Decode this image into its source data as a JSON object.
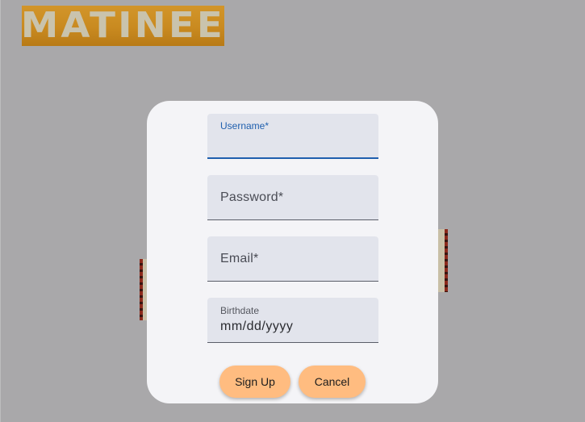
{
  "app": {
    "logo_text": "MATINEE"
  },
  "form": {
    "username": {
      "label": "Username*",
      "value": ""
    },
    "password": {
      "label": "Password*",
      "value": ""
    },
    "email": {
      "label": "Email*",
      "value": ""
    },
    "birthdate": {
      "label": "Birthdate",
      "placeholder": "mm/dd/yyyy"
    }
  },
  "buttons": {
    "sign_up": "Sign Up",
    "cancel": "Cancel"
  },
  "colors": {
    "background": "#a9a8aa",
    "dialog": "#f4f4f7",
    "field": "#e2e4ec",
    "focus_accent": "#1f5fae",
    "button": "#ffbc80",
    "logo": "#c98a20"
  }
}
